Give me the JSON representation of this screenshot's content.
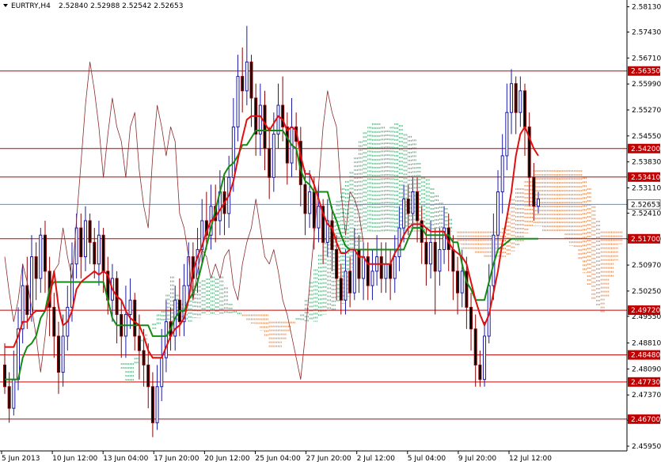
{
  "header": {
    "symbol": "EURTRY,H4",
    "ohlc": "2.52840 2.52988 2.52542 2.52653"
  },
  "chart_data": {
    "type": "candlestick",
    "symbol": "EURTRY",
    "timeframe": "H4",
    "ohlc_last": {
      "open": 2.5284,
      "high": 2.52988,
      "low": 2.52542,
      "close": 2.52653
    },
    "ylim": [
      2.4595,
      2.5823
    ],
    "y_ticks": [
      "2.58130",
      "2.57430",
      "2.56710",
      "2.55990",
      "2.55270",
      "2.54550",
      "2.53830",
      "2.53110",
      "2.52410",
      "2.51690",
      "2.50970",
      "2.50250",
      "2.49550",
      "2.48810",
      "2.48090",
      "2.47370",
      "2.46670",
      "2.45950"
    ],
    "x_ticks": [
      "5 Jun 2013",
      "10 Jun 12:00",
      "13 Jun 04:00",
      "17 Jun 20:00",
      "20 Jun 12:00",
      "25 Jun 04:00",
      "27 Jun 20:00",
      "2 Jul 12:00",
      "5 Jul 04:00",
      "9 Jul 20:00",
      "12 Jul 12:00"
    ],
    "levels": [
      {
        "label": "2.56350",
        "value": 2.5635
      },
      {
        "label": "2.54200",
        "value": 2.542
      },
      {
        "label": "2.53410",
        "value": 2.5341
      },
      {
        "label": "2.51700",
        "value": 2.517
      },
      {
        "label": "2.49720",
        "value": 2.4972
      },
      {
        "label": "2.48480",
        "value": 2.4848
      },
      {
        "label": "2.47730",
        "value": 2.4773
      },
      {
        "label": "2.46700",
        "value": 2.467
      }
    ],
    "current_price": {
      "label": "2.52653",
      "value": 2.52653
    },
    "candles": [
      [
        2.482,
        2.476,
        2.488,
        2.474
      ],
      [
        2.476,
        2.47,
        2.48,
        2.466
      ],
      [
        2.47,
        2.478,
        2.486,
        2.468
      ],
      [
        2.478,
        2.492,
        2.498,
        2.475
      ],
      [
        2.492,
        2.504,
        2.51,
        2.488
      ],
      [
        2.504,
        2.496,
        2.512,
        2.492
      ],
      [
        2.496,
        2.512,
        2.518,
        2.494
      ],
      [
        2.512,
        2.506,
        2.516,
        2.5
      ],
      [
        2.506,
        2.518,
        2.52,
        2.502
      ],
      [
        2.518,
        2.508,
        2.522,
        2.502
      ],
      [
        2.508,
        2.498,
        2.512,
        2.49
      ],
      [
        2.498,
        2.49,
        2.502,
        2.484
      ],
      [
        2.49,
        2.48,
        2.494,
        2.474
      ],
      [
        2.48,
        2.49,
        2.496,
        2.476
      ],
      [
        2.49,
        2.498,
        2.504,
        2.486
      ],
      [
        2.498,
        2.51,
        2.516,
        2.494
      ],
      [
        2.51,
        2.52,
        2.524,
        2.506
      ],
      [
        2.52,
        2.512,
        2.524,
        2.506
      ],
      [
        2.512,
        2.522,
        2.526,
        2.508
      ],
      [
        2.522,
        2.516,
        2.524,
        2.51
      ],
      [
        2.516,
        2.51,
        2.52,
        2.506
      ],
      [
        2.51,
        2.518,
        2.522,
        2.504
      ],
      [
        2.518,
        2.508,
        2.52,
        2.502
      ],
      [
        2.508,
        2.5,
        2.512,
        2.496
      ],
      [
        2.5,
        2.506,
        2.51,
        2.494
      ],
      [
        2.506,
        2.496,
        2.508,
        2.488
      ],
      [
        2.496,
        2.49,
        2.5,
        2.484
      ],
      [
        2.49,
        2.496,
        2.504,
        2.484
      ],
      [
        2.496,
        2.5,
        2.506,
        2.492
      ],
      [
        2.5,
        2.49,
        2.502,
        2.486
      ],
      [
        2.49,
        2.486,
        2.496,
        2.478
      ],
      [
        2.486,
        2.482,
        2.492,
        2.476
      ],
      [
        2.482,
        2.476,
        2.488,
        2.47
      ],
      [
        2.476,
        2.466,
        2.48,
        2.462
      ],
      [
        2.466,
        2.476,
        2.482,
        2.464
      ],
      [
        2.476,
        2.484,
        2.492,
        2.472
      ],
      [
        2.484,
        2.494,
        2.5,
        2.48
      ],
      [
        2.494,
        2.49,
        2.498,
        2.486
      ],
      [
        2.49,
        2.5,
        2.504,
        2.486
      ],
      [
        2.5,
        2.494,
        2.506,
        2.49
      ],
      [
        2.494,
        2.504,
        2.51,
        2.49
      ],
      [
        2.504,
        2.512,
        2.516,
        2.5
      ],
      [
        2.512,
        2.506,
        2.516,
        2.5
      ],
      [
        2.506,
        2.514,
        2.52,
        2.502
      ],
      [
        2.514,
        2.522,
        2.528,
        2.51
      ],
      [
        2.522,
        2.518,
        2.53,
        2.514
      ],
      [
        2.518,
        2.526,
        2.532,
        2.514
      ],
      [
        2.526,
        2.522,
        2.532,
        2.516
      ],
      [
        2.522,
        2.53,
        2.536,
        2.518
      ],
      [
        2.53,
        2.524,
        2.534,
        2.518
      ],
      [
        2.524,
        2.534,
        2.54,
        2.52
      ],
      [
        2.534,
        2.548,
        2.556,
        2.53
      ],
      [
        2.548,
        2.562,
        2.568,
        2.544
      ],
      [
        2.562,
        2.558,
        2.57,
        2.552
      ],
      [
        2.558,
        2.566,
        2.576,
        2.554
      ],
      [
        2.566,
        2.556,
        2.568,
        2.548
      ],
      [
        2.556,
        2.546,
        2.56,
        2.54
      ],
      [
        2.546,
        2.554,
        2.56,
        2.54
      ],
      [
        2.554,
        2.542,
        2.558,
        2.536
      ],
      [
        2.542,
        2.534,
        2.548,
        2.528
      ],
      [
        2.534,
        2.546,
        2.552,
        2.53
      ],
      [
        2.546,
        2.554,
        2.56,
        2.542
      ],
      [
        2.554,
        2.548,
        2.562,
        2.544
      ],
      [
        2.548,
        2.538,
        2.552,
        2.532
      ],
      [
        2.538,
        2.548,
        2.556,
        2.534
      ],
      [
        2.548,
        2.544,
        2.552,
        2.536
      ],
      [
        2.544,
        2.532,
        2.548,
        2.526
      ],
      [
        2.532,
        2.524,
        2.536,
        2.518
      ],
      [
        2.524,
        2.53,
        2.536,
        2.52
      ],
      [
        2.53,
        2.52,
        2.534,
        2.514
      ],
      [
        2.52,
        2.526,
        2.532,
        2.516
      ],
      [
        2.526,
        2.516,
        2.528,
        2.51
      ],
      [
        2.516,
        2.522,
        2.528,
        2.512
      ],
      [
        2.522,
        2.514,
        2.526,
        2.508
      ],
      [
        2.514,
        2.506,
        2.518,
        2.5
      ],
      [
        2.506,
        2.5,
        2.51,
        2.496
      ],
      [
        2.5,
        2.508,
        2.514,
        2.496
      ],
      [
        2.508,
        2.502,
        2.512,
        2.498
      ],
      [
        2.502,
        2.514,
        2.52,
        2.5
      ],
      [
        2.514,
        2.506,
        2.518,
        2.502
      ],
      [
        2.506,
        2.512,
        2.516,
        2.5
      ],
      [
        2.512,
        2.504,
        2.516,
        2.5
      ],
      [
        2.504,
        2.508,
        2.514,
        2.5
      ],
      [
        2.508,
        2.512,
        2.518,
        2.504
      ],
      [
        2.512,
        2.506,
        2.516,
        2.502
      ],
      [
        2.506,
        2.51,
        2.516,
        2.502
      ],
      [
        2.51,
        2.506,
        2.514,
        2.5
      ],
      [
        2.506,
        2.512,
        2.518,
        2.502
      ],
      [
        2.512,
        2.52,
        2.526,
        2.508
      ],
      [
        2.52,
        2.528,
        2.532,
        2.516
      ],
      [
        2.528,
        2.524,
        2.532,
        2.518
      ],
      [
        2.524,
        2.53,
        2.534,
        2.52
      ],
      [
        2.53,
        2.522,
        2.534,
        2.516
      ],
      [
        2.522,
        2.516,
        2.526,
        2.51
      ],
      [
        2.516,
        2.51,
        2.52,
        2.504
      ],
      [
        2.51,
        2.516,
        2.522,
        2.506
      ],
      [
        2.516,
        2.508,
        2.52,
        2.496
      ],
      [
        2.508,
        2.514,
        2.52,
        2.504
      ],
      [
        2.514,
        2.52,
        2.526,
        2.51
      ],
      [
        2.52,
        2.514,
        2.524,
        2.508
      ],
      [
        2.514,
        2.508,
        2.518,
        2.5
      ],
      [
        2.508,
        2.502,
        2.512,
        2.496
      ],
      [
        2.502,
        2.508,
        2.514,
        2.498
      ],
      [
        2.508,
        2.498,
        2.512,
        2.492
      ],
      [
        2.498,
        2.492,
        2.502,
        2.486
      ],
      [
        2.492,
        2.482,
        2.496,
        2.476
      ],
      [
        2.482,
        2.478,
        2.486,
        2.476
      ],
      [
        2.478,
        2.49,
        2.494,
        2.476
      ],
      [
        2.49,
        2.504,
        2.51,
        2.488
      ],
      [
        2.504,
        2.518,
        2.524,
        2.5
      ],
      [
        2.518,
        2.53,
        2.536,
        2.514
      ],
      [
        2.53,
        2.54,
        2.546,
        2.524
      ],
      [
        2.54,
        2.552,
        2.56,
        2.536
      ],
      [
        2.552,
        2.56,
        2.564,
        2.546
      ],
      [
        2.56,
        2.552,
        2.562,
        2.546
      ],
      [
        2.552,
        2.558,
        2.562,
        2.548
      ],
      [
        2.558,
        2.548,
        2.56,
        2.54
      ],
      [
        2.548,
        2.534,
        2.552,
        2.526
      ],
      [
        2.534,
        2.526,
        2.538,
        2.522
      ],
      [
        2.526,
        2.528,
        2.53,
        2.524
      ]
    ],
    "tenkan_sen": [
      2.487,
      2.487,
      2.487,
      2.49,
      2.494,
      2.494,
      2.496,
      2.497,
      2.497,
      2.497,
      2.5,
      2.508,
      2.498,
      2.493,
      2.494,
      2.497,
      2.503,
      2.505,
      2.506,
      2.507,
      2.508,
      2.507,
      2.508,
      2.507,
      2.503,
      2.501,
      2.5,
      2.497,
      2.495,
      2.494,
      2.493,
      2.49,
      2.486,
      2.484,
      2.484,
      2.484,
      2.487,
      2.49,
      2.492,
      2.493,
      2.495,
      2.5,
      2.508,
      2.512,
      2.515,
      2.519,
      2.522,
      2.523,
      2.525,
      2.527,
      2.529,
      2.533,
      2.539,
      2.545,
      2.55,
      2.551,
      2.551,
      2.551,
      2.549,
      2.547,
      2.549,
      2.551,
      2.55,
      2.547,
      2.548,
      2.547,
      2.54,
      2.535,
      2.535,
      2.532,
      2.528,
      2.524,
      2.521,
      2.52,
      2.516,
      2.513,
      2.513,
      2.514,
      2.514,
      2.512,
      2.512,
      2.51,
      2.51,
      2.51,
      2.51,
      2.51,
      2.51,
      2.513,
      2.515,
      2.518,
      2.52,
      2.521,
      2.521,
      2.521,
      2.52,
      2.519,
      2.519,
      2.519,
      2.519,
      2.516,
      2.514,
      2.513,
      2.512,
      2.51,
      2.505,
      2.5,
      2.496,
      2.493,
      2.496,
      2.502,
      2.508,
      2.516,
      2.523,
      2.53,
      2.54,
      2.546,
      2.548,
      2.545,
      2.542,
      2.54
    ],
    "kijun_sen": [
      2.478,
      2.478,
      2.478,
      2.478,
      2.484,
      2.487,
      2.488,
      2.49,
      2.495,
      2.497,
      2.503,
      2.505,
      2.505,
      2.505,
      2.505,
      2.505,
      2.505,
      2.505,
      2.505,
      2.505,
      2.505,
      2.505,
      2.505,
      2.5,
      2.495,
      2.493,
      2.493,
      2.493,
      2.493,
      2.493,
      2.493,
      2.493,
      2.493,
      2.49,
      2.49,
      2.49,
      2.49,
      2.492,
      2.495,
      2.497,
      2.497,
      2.5,
      2.502,
      2.505,
      2.51,
      2.515,
      2.52,
      2.525,
      2.53,
      2.535,
      2.537,
      2.538,
      2.54,
      2.543,
      2.543,
      2.545,
      2.547,
      2.547,
      2.547,
      2.547,
      2.547,
      2.547,
      2.547,
      2.545,
      2.543,
      2.542,
      2.536,
      2.533,
      2.532,
      2.53,
      2.53,
      2.53,
      2.53,
      2.525,
      2.522,
      2.518,
      2.515,
      2.514,
      2.514,
      2.514,
      2.514,
      2.514,
      2.514,
      2.514,
      2.514,
      2.514,
      2.514,
      2.514,
      2.514,
      2.514,
      2.517,
      2.52,
      2.52,
      2.52,
      2.518,
      2.518,
      2.518,
      2.518,
      2.518,
      2.518,
      2.516,
      2.516,
      2.51,
      2.505,
      2.503,
      2.5,
      2.5,
      2.5,
      2.505,
      2.51,
      2.514,
      2.515,
      2.516,
      2.517,
      2.517,
      2.517,
      2.517,
      2.517,
      2.517,
      2.517
    ],
    "chikou_span": [
      2.512,
      2.502,
      2.494,
      2.5,
      2.51,
      2.505,
      2.498,
      2.49,
      2.48,
      2.49,
      2.503,
      2.508,
      2.51,
      2.52,
      2.512,
      2.506,
      2.522,
      2.538,
      2.554,
      2.566,
      2.558,
      2.548,
      2.534,
      2.546,
      2.556,
      2.548,
      2.544,
      2.534,
      2.548,
      2.552,
      2.536,
      2.526,
      2.52,
      2.54,
      2.554,
      2.548,
      2.54,
      2.548,
      2.544,
      2.524,
      2.52,
      2.512,
      2.5,
      2.508,
      2.514,
      2.512,
      2.506,
      2.51,
      2.506,
      2.512,
      2.514,
      2.504,
      2.5,
      2.51,
      2.516,
      2.52,
      2.528,
      2.52,
      2.512,
      2.51,
      2.514,
      2.508,
      2.5,
      2.496,
      2.49,
      2.484,
      2.478,
      2.49,
      2.504,
      2.518,
      2.532,
      2.548,
      2.558,
      2.552,
      2.548,
      2.53,
      2.518,
      2.53,
      2.528,
      2.524,
      2.516
    ]
  }
}
